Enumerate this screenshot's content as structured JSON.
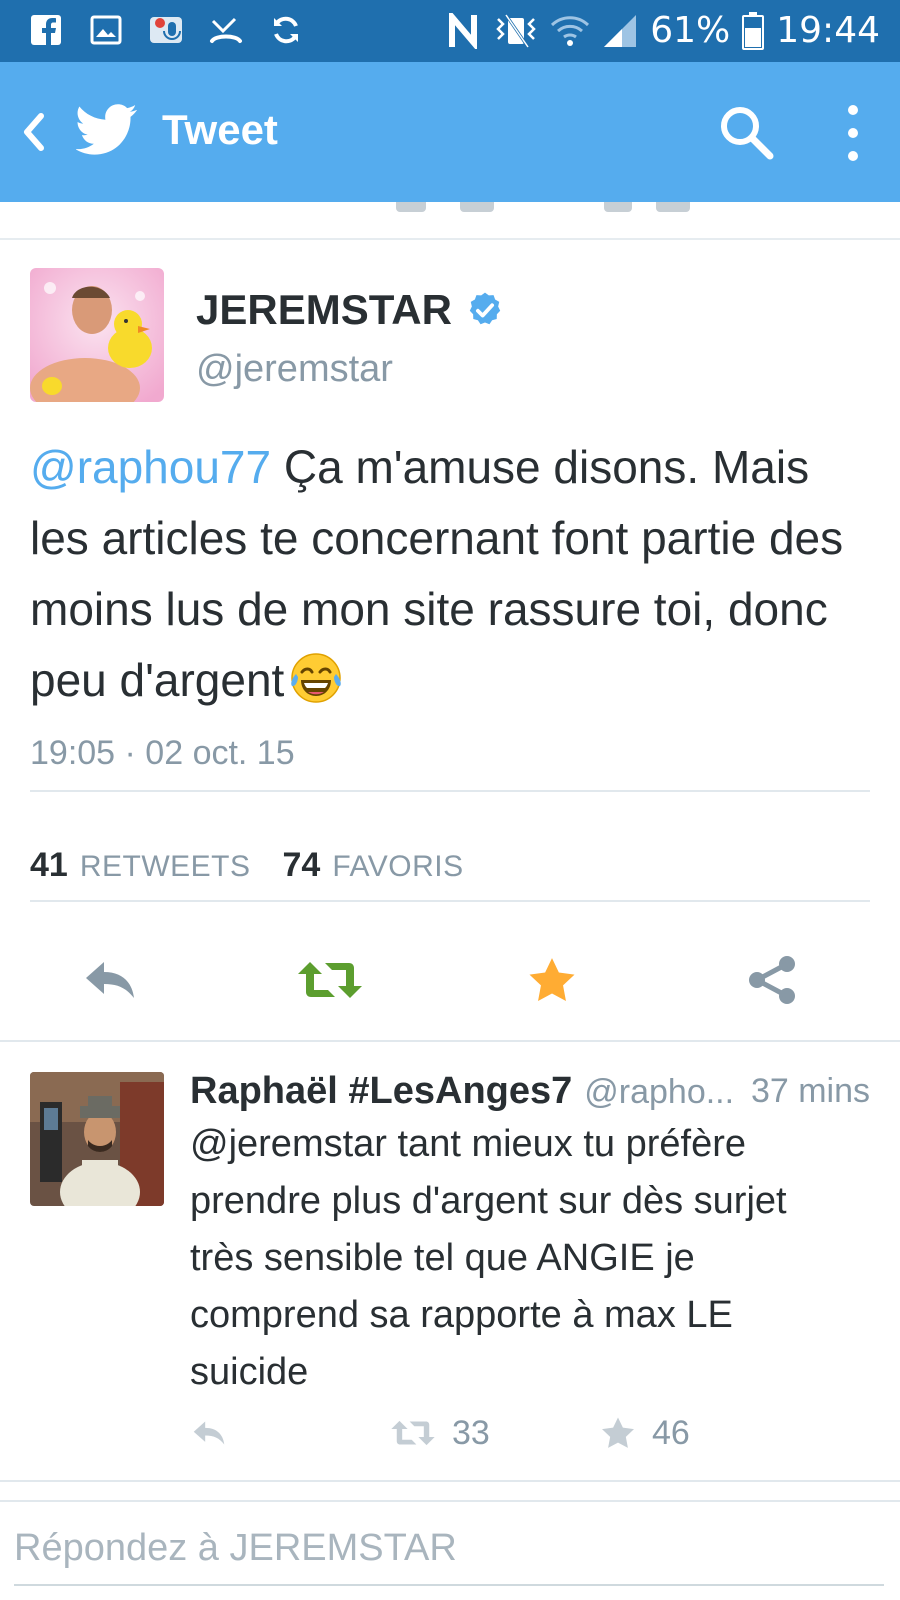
{
  "status_bar": {
    "battery_percent": "61%",
    "time": "19:44",
    "left_icons": [
      "facebook-icon",
      "gallery-icon",
      "voicemail-icon",
      "missed-call-icon",
      "sync-icon"
    ],
    "right_icons": [
      "nfc-icon",
      "vibrate-icon",
      "wifi-icon",
      "signal-icon",
      "battery-icon"
    ]
  },
  "app_bar": {
    "title": "Tweet",
    "accent": "#55acee"
  },
  "tweet": {
    "author_name": "JEREMSTAR",
    "author_handle": "@jeremstar",
    "verified": true,
    "mention": "@raphou77",
    "text": "Ça m'amuse disons. Mais les articles te concernant font partie des moins lus de mon site rassure toi, donc peu d'argent",
    "emoji": "face-with-tears-of-joy-icon",
    "timestamp": "19:05 · 02 oct. 15",
    "retweets_count": "41",
    "retweets_label": "RETWEETS",
    "favorites_count": "74",
    "favorites_label": "FAVORIS",
    "favorited": true,
    "colors": {
      "retweet_green": "#5c9e2f",
      "favorite_orange": "#ffac33",
      "icon_gray": "#8899a6"
    }
  },
  "reply": {
    "author_name": "Raphaël #LesAnges7",
    "author_handle": "@rapho...",
    "time": "37 mins",
    "text": "@jeremstar tant mieux tu préfère prendre plus d'argent sur dès surjet très sensible tel que ANGIE je comprend sa rapporte à max LE suicide",
    "retweets_count": "33",
    "favorites_count": "46"
  },
  "compose": {
    "placeholder": "Répondez à JEREMSTAR"
  }
}
